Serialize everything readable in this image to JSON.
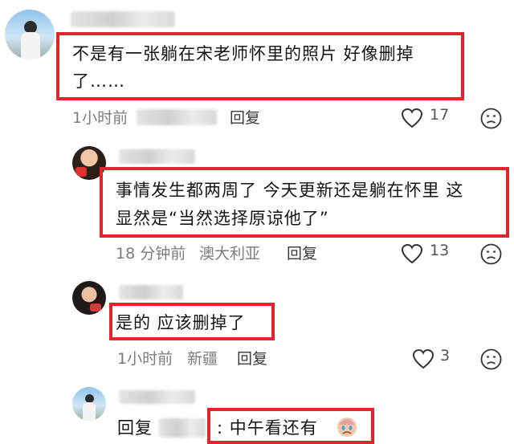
{
  "comments": [
    {
      "text": "不是有一张躺在宋老师怀里的照片 好像删掉了……",
      "line1": "不是有一张躺在宋老师怀里的照片 好像删掉",
      "line2": "了……",
      "time": "1小时前",
      "reply_label": "回复",
      "likes": "17"
    },
    {
      "text": "事情发生都两周了 今天更新还是躺在怀里 这显然是“当然选择原谅他了”",
      "line1": "事情发生都两周了 今天更新还是躺在怀里 这",
      "line2": "显然是“当然选择原谅他了”",
      "time": "18 分钟前",
      "location": "澳大利亚",
      "reply_label": "回复",
      "likes": "13"
    },
    {
      "text": "是的 应该删掉了",
      "time": "1小时前",
      "location": "新疆",
      "reply_label": "回复",
      "likes": "3"
    },
    {
      "prefix": "回复",
      "text": ": 中午看还有"
    }
  ],
  "colors": {
    "highlight": "#e0262c",
    "meta": "#7c7c7c"
  },
  "icons": [
    "heart-icon",
    "sad-face-icon",
    "emoji-icon"
  ]
}
